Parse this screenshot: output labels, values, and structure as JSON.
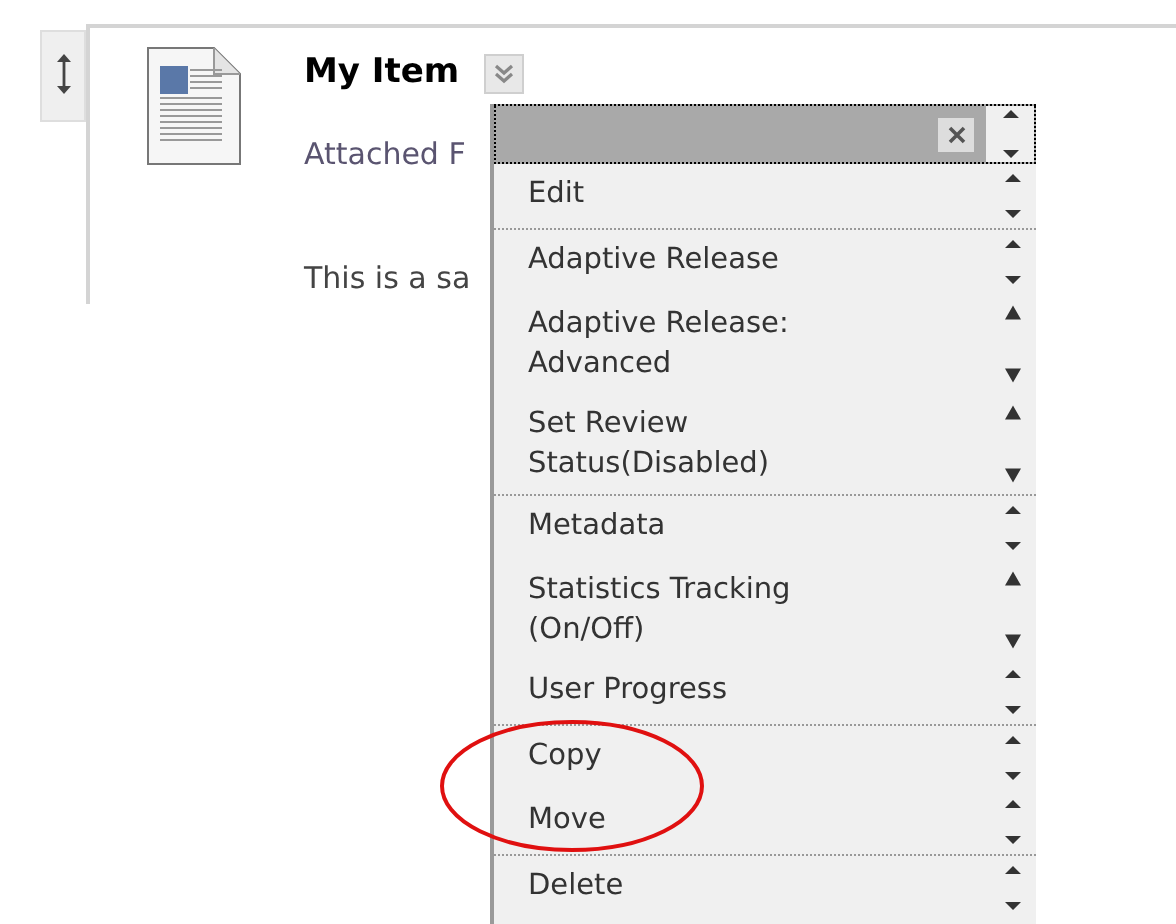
{
  "item": {
    "title": "My Item",
    "attachment_label": "Attached F",
    "description": "This is a sa"
  },
  "menu": {
    "groups": [
      {
        "items": [
          {
            "label": "Edit"
          }
        ]
      },
      {
        "items": [
          {
            "label": "Adaptive Release"
          },
          {
            "label": "Adaptive Release: Advanced"
          },
          {
            "label": "Set Review Status(Disabled)"
          }
        ]
      },
      {
        "items": [
          {
            "label": "Metadata"
          },
          {
            "label": "Statistics Tracking (On/Off)"
          },
          {
            "label": "User Progress"
          }
        ]
      },
      {
        "items": [
          {
            "label": "Copy"
          },
          {
            "label": "Move"
          }
        ]
      },
      {
        "items": [
          {
            "label": "Delete"
          }
        ]
      }
    ]
  }
}
